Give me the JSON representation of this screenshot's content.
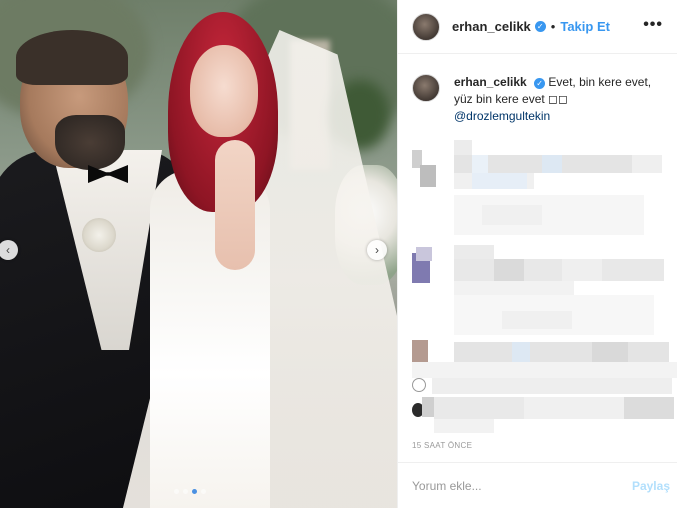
{
  "post": {
    "image_alt": "Wedding photo of a bearded man in a tuxedo and a red-haired bride in a white dress with veil",
    "carousel_count": 4,
    "carousel_active": 3
  },
  "header": {
    "username": "erhan_celikk",
    "verified_mark": "✓",
    "separator": "•",
    "follow_label": "Takip Et",
    "more_label": "•••"
  },
  "caption": {
    "username": "erhan_celikk",
    "verified_mark": "✓",
    "text": " Evet, bin kere evet, yüz bin kere evet ◻◻ ",
    "mention": "@drozlemgultekin"
  },
  "meta": {
    "timestamp": "15 SAAT ÖNCE"
  },
  "footer": {
    "comment_placeholder": "Yorum ekle...",
    "post_label": "Paylaş"
  },
  "colors": {
    "accent": "#3897f0",
    "mention": "#003569",
    "post_disabled": "#b2dffc"
  }
}
